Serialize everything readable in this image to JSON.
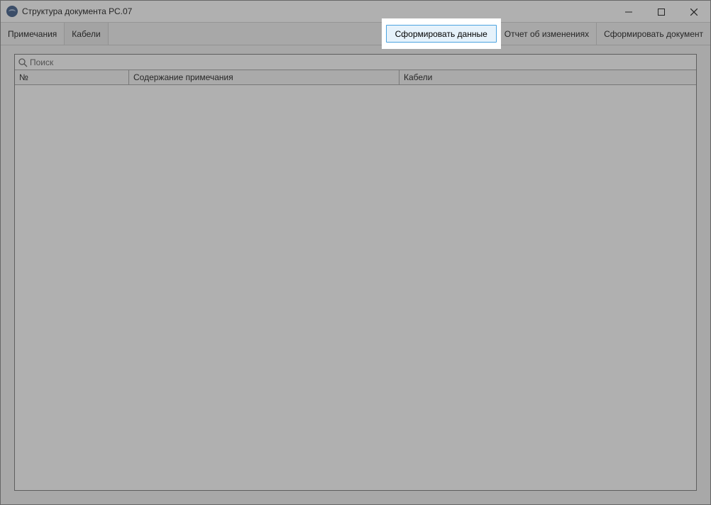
{
  "window": {
    "title": "Структура документа РС.07"
  },
  "tabs": {
    "notes": "Примечания",
    "cables": "Кабели"
  },
  "toolbar": {
    "form_data": "Сформировать данные",
    "change_report": "Отчет об изменениях",
    "form_document": "Сформировать документ"
  },
  "search": {
    "placeholder": "Поиск"
  },
  "columns": {
    "num": "№",
    "content": "Содержание примечания",
    "cables": "Кабели"
  }
}
